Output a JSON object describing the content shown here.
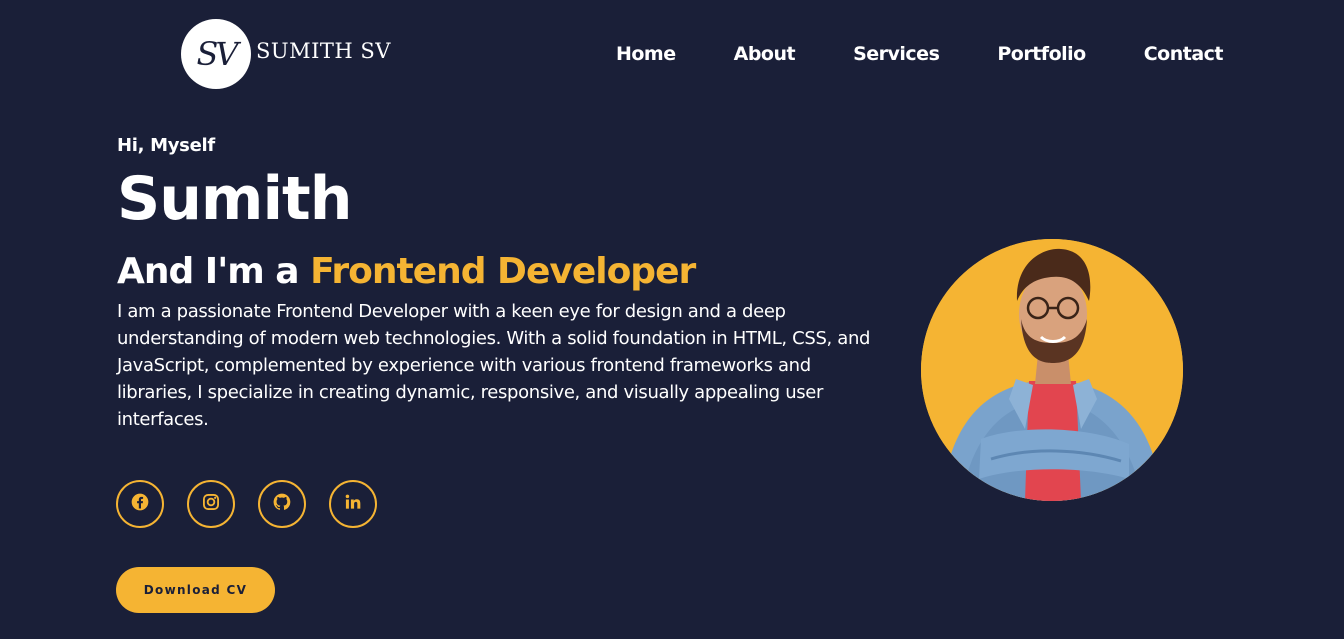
{
  "header": {
    "logo_monogram": "SV",
    "logo_name": "SUMITH SV",
    "nav": [
      "Home",
      "About",
      "Services",
      "Portfolio",
      "Contact"
    ]
  },
  "hero": {
    "greeting": "Hi, Myself",
    "name": "Sumith",
    "role_prefix": "And I'm a ",
    "role_highlight": "Frontend Developer",
    "bio": "I am a passionate Frontend Developer with a keen eye for design and a deep understanding of modern web technologies. With a solid foundation in HTML, CSS, and JavaScript, complemented by experience with various frontend frameworks and libraries, I specialize in creating dynamic, responsive, and visually appealing user interfaces."
  },
  "socials": [
    {
      "icon": "facebook-icon"
    },
    {
      "icon": "instagram-icon"
    },
    {
      "icon": "github-icon"
    },
    {
      "icon": "linkedin-icon"
    }
  ],
  "cta": {
    "label": "Download CV"
  },
  "colors": {
    "background": "#1a1f38",
    "accent": "#f5b433",
    "text": "#ffffff"
  }
}
